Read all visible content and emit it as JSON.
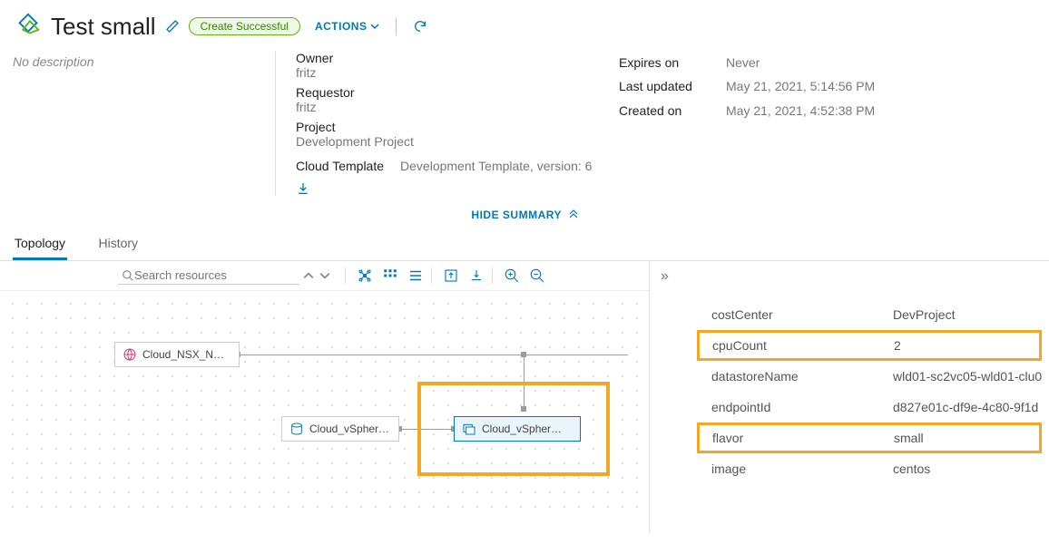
{
  "header": {
    "title": "Test small",
    "status": "Create Successful",
    "actions_label": "ACTIONS"
  },
  "summary": {
    "description_placeholder": "No description",
    "owner_label": "Owner",
    "owner": "fritz",
    "requestor_label": "Requestor",
    "requestor": "fritz",
    "project_label": "Project",
    "project": "Development Project",
    "template_label": "Cloud Template",
    "template": "Development Template, version: 6",
    "expires_label": "Expires on",
    "expires": "Never",
    "updated_label": "Last updated",
    "updated": "May 21, 2021, 5:14:56 PM",
    "created_label": "Created on",
    "created": "May 21, 2021, 4:52:38 PM",
    "hide_label": "HIDE SUMMARY"
  },
  "tabs": {
    "topology": "Topology",
    "history": "History"
  },
  "search": {
    "placeholder": "Search resources"
  },
  "nodes": {
    "nsx": "Cloud_NSX_N…",
    "disk": "Cloud_vSpher…",
    "vm": "Cloud_vSpher…"
  },
  "properties": [
    {
      "key": "costCenter",
      "value": "DevProject",
      "hl": false
    },
    {
      "key": "cpuCount",
      "value": "2",
      "hl": true
    },
    {
      "key": "datastoreName",
      "value": "wld01-sc2vc05-wld01-clu0",
      "hl": false
    },
    {
      "key": "endpointId",
      "value": "d827e01c-df9e-4c80-9f1d",
      "hl": false
    },
    {
      "key": "flavor",
      "value": "small",
      "hl": true
    },
    {
      "key": "image",
      "value": "centos",
      "hl": false
    }
  ]
}
